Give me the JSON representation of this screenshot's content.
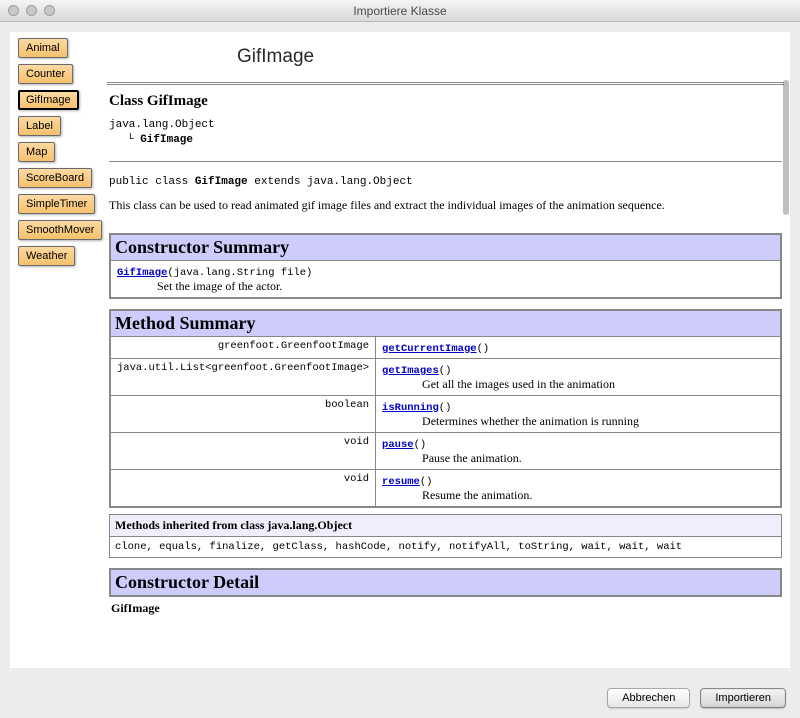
{
  "window": {
    "title": "Importiere Klasse"
  },
  "sidebar": {
    "items": [
      {
        "label": "Animal"
      },
      {
        "label": "Counter"
      },
      {
        "label": "GifImage",
        "selected": true
      },
      {
        "label": "Label"
      },
      {
        "label": "Map"
      },
      {
        "label": "ScoreBoard"
      },
      {
        "label": "SimpleTimer"
      },
      {
        "label": "SmoothMover"
      },
      {
        "label": "Weather"
      }
    ]
  },
  "doc": {
    "title": "GifImage",
    "class_heading": "Class GifImage",
    "hierarchy_root": "java.lang.Object",
    "hierarchy_leaf": "GifImage",
    "decl_pre": "public class ",
    "decl_name": "GifImage",
    "decl_post": " extends java.lang.Object",
    "description": "This class can be used to read animated gif image files and extract the individual images of the animation sequence.",
    "constructor_summary_title": "Constructor Summary",
    "constructors": [
      {
        "link": "GifImage",
        "sig": "(java.lang.String file)",
        "desc": "Set the image of the actor."
      }
    ],
    "method_summary_title": "Method Summary",
    "methods": [
      {
        "ret": "greenfoot.GreenfootImage",
        "link": "getCurrentImage",
        "sig": "()",
        "desc": ""
      },
      {
        "ret": "java.util.List<greenfoot.GreenfootImage>",
        "link": "getImages",
        "sig": "()",
        "desc": "Get all the images used in the animation"
      },
      {
        "ret": "boolean",
        "link": "isRunning",
        "sig": "()",
        "desc": "Determines whether the animation is running"
      },
      {
        "ret": "void",
        "link": "pause",
        "sig": "()",
        "desc": "Pause the animation."
      },
      {
        "ret": "void",
        "link": "resume",
        "sig": "()",
        "desc": "Resume the animation."
      }
    ],
    "inherited_title": "Methods inherited from class java.lang.Object",
    "inherited_methods": "clone, equals, finalize, getClass, hashCode, notify, notifyAll, toString, wait, wait, wait",
    "constructor_detail_title": "Constructor Detail",
    "constructor_detail_sub": "GifImage"
  },
  "buttons": {
    "cancel": "Abbrechen",
    "import": "Importieren"
  }
}
